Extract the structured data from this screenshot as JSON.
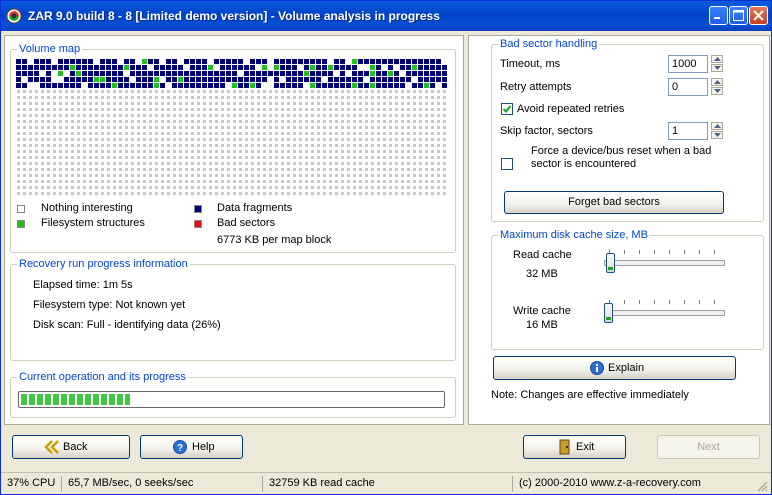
{
  "window": {
    "title": "ZAR 9.0 build 8 - 8 [Limited demo version] - Volume analysis in progress"
  },
  "volume_map": {
    "title": "Volume map",
    "legend": {
      "nothing": "Nothing interesting",
      "filesystem": "Filesystem structures",
      "data": "Data fragments",
      "bad": "Bad sectors",
      "per_block": "6773 KB per map block"
    },
    "colors": {
      "nothing": "#c8c8c8",
      "filesystem": "#21c021",
      "data": "#000078",
      "bad": "#e01010"
    },
    "grid": {
      "columns": 72,
      "rows": 23,
      "data_rows": 5
    }
  },
  "recovery": {
    "title": "Recovery run progress information",
    "elapsed": "Elapsed time: 1m 5s",
    "fs_type": "Filesystem type: Not known yet",
    "scan": "Disk scan: Full - identifying data (26%)"
  },
  "current_op": {
    "title": "Current operation and its progress",
    "progress": 0.26
  },
  "bad_sector": {
    "title": "Bad sector handling",
    "timeout_label": "Timeout, ms",
    "timeout_value": "1000",
    "retry_label": "Retry attempts",
    "retry_value": "0",
    "avoid_label": "Avoid repeated retries",
    "avoid_checked": true,
    "skip_label": "Skip factor, sectors",
    "skip_value": "1",
    "reset_label_1": "Force a device/bus reset when a bad",
    "reset_label_2": "sector is encountered",
    "reset_checked": false,
    "forget_button": "Forget bad sectors"
  },
  "cache": {
    "title": "Maximum disk cache size, MB",
    "read_label": "Read cache",
    "read_value": "32 MB",
    "write_label": "Write cache",
    "write_value": "16 MB",
    "explain_button": "Explain",
    "note": "Note: Changes are effective immediately"
  },
  "nav": {
    "back": "Back",
    "help": "Help",
    "exit": "Exit",
    "next": "Next"
  },
  "status": {
    "cpu": "37% CPU",
    "speed": "65,7 MB/sec, 0 seeks/sec",
    "cache": "32759 KB read cache",
    "copyright": "(c) 2000-2010 www.z-a-recovery.com"
  },
  "icons": [
    "app-icon",
    "minimize-icon",
    "maximize-icon",
    "close-icon",
    "check-icon",
    "spin-up-icon",
    "spin-down-icon",
    "info-icon",
    "back-arrow-icon",
    "help-icon",
    "exit-door-icon",
    "resize-grip-icon"
  ]
}
